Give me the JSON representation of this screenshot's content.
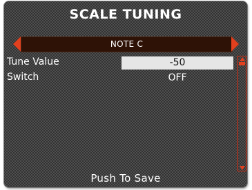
{
  "header": {
    "title": "SCALE TUNING"
  },
  "selector": {
    "label": "NOTE C",
    "left_icon": "triangle-left",
    "right_icon": "triangle-right"
  },
  "params": [
    {
      "label": "Tune Value",
      "value": "-50"
    },
    {
      "label": "Switch",
      "value": "OFF"
    }
  ],
  "footer": {
    "text": "Push To Save"
  },
  "colors": {
    "accent": "#e2401e",
    "selector_bg": "#2e1206",
    "highlight": "#e6e6e6",
    "screen_bg": "#1a1a1a"
  }
}
